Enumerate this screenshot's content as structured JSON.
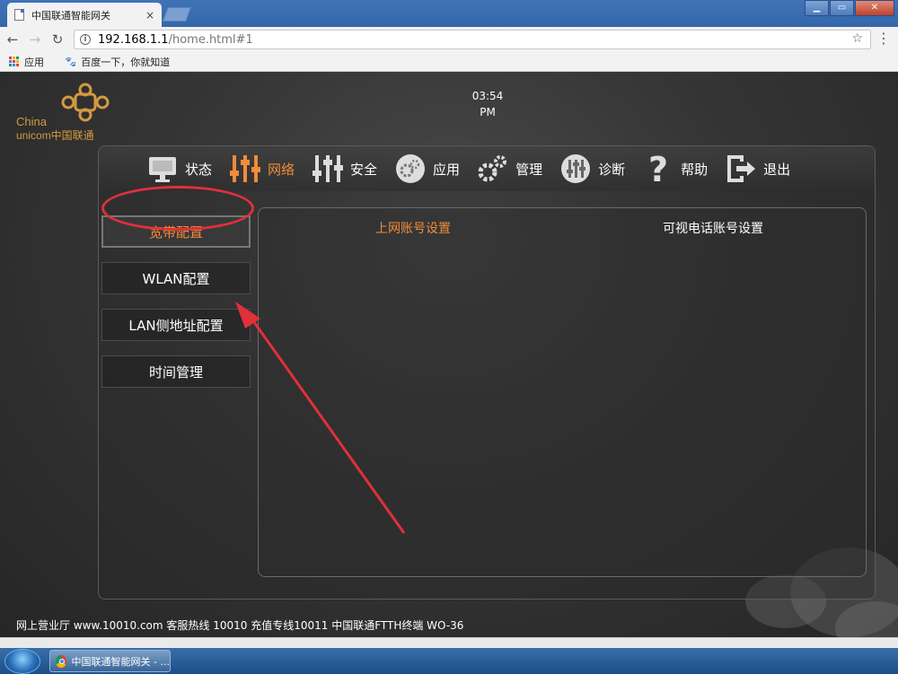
{
  "browser": {
    "tab_title": "中国联通智能网关",
    "tab_close": "×",
    "url_host": "192.168.1.1",
    "url_path": "/home.html#1",
    "bookmarks": [
      {
        "label": "应用",
        "icon": "apps-grid-icon"
      },
      {
        "label": "百度一下，你就知道",
        "icon": "baidu-paw-icon"
      }
    ],
    "window_buttons": [
      "minimize",
      "maximize",
      "close"
    ]
  },
  "header": {
    "logo_line1": "China",
    "logo_line2": "unicom中国联通",
    "clock_time": "03:54",
    "clock_period": "PM"
  },
  "topnav": [
    {
      "label": "状态",
      "icon": "monitor-icon",
      "active": false
    },
    {
      "label": "网络",
      "icon": "sliders-icon",
      "active": true
    },
    {
      "label": "安全",
      "icon": "security-sliders-icon",
      "active": false
    },
    {
      "label": "应用",
      "icon": "gear-icon",
      "active": false
    },
    {
      "label": "管理",
      "icon": "gears-icon",
      "active": false
    },
    {
      "label": "诊断",
      "icon": "diagnose-icon",
      "active": false
    },
    {
      "label": "帮助",
      "icon": "question-icon",
      "active": false
    },
    {
      "label": "退出",
      "icon": "logout-icon",
      "active": false
    }
  ],
  "sidebar": [
    {
      "label": "宽带配置",
      "active": true
    },
    {
      "label": "WLAN配置",
      "active": false
    },
    {
      "label": "LAN侧地址配置",
      "active": false
    },
    {
      "label": "时间管理",
      "active": false
    }
  ],
  "content_tabs": [
    {
      "label": "上网账号设置",
      "active": true
    },
    {
      "label": "可视电话账号设置",
      "active": false
    }
  ],
  "footer": {
    "text": "网上营业厅 www.10010.com 客服热线 10010 充值专线10011 中国联通FTTH终端 WO-36"
  },
  "taskbar": {
    "task_label": "中国联通智能网关 - ..."
  },
  "colors": {
    "accent_orange": "#f08c3a",
    "logo_gold": "#d39a3f",
    "annotation_red": "#e0303a"
  }
}
